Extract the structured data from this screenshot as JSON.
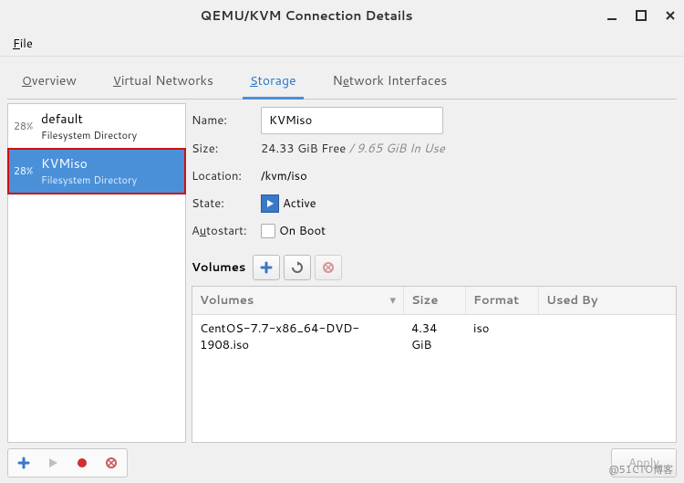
{
  "window": {
    "title": "QEMU/KVM Connection Details"
  },
  "menubar": {
    "file": "File"
  },
  "tabs": {
    "overview": "Overview",
    "virtual_networks": "Virtual Networks",
    "storage": "Storage",
    "network_interfaces": "Network Interfaces"
  },
  "pools": [
    {
      "percent": "28%",
      "name": "default",
      "type": "Filesystem Directory"
    },
    {
      "percent": "28%",
      "name": "KVMiso",
      "type": "Filesystem Directory"
    }
  ],
  "details": {
    "name_label": "Name:",
    "name_value": "KVMiso",
    "size_label": "Size:",
    "size_free": "24.33 GiB Free",
    "size_sep": " / ",
    "size_use": "9.65 GiB In Use",
    "location_label": "Location:",
    "location_value": "/kvm/iso",
    "state_label": "State:",
    "state_value": "Active",
    "autostart_label": "Autostart:",
    "autostart_value": "On Boot"
  },
  "volumes": {
    "header_label": "Volumes",
    "columns": {
      "volumes": "Volumes",
      "size": "Size",
      "format": "Format",
      "used_by": "Used By"
    },
    "rows": [
      {
        "name": "CentOS-7.7-x86_64-DVD-1908.iso",
        "size": "4.34 GiB",
        "format": "iso",
        "used_by": ""
      }
    ]
  },
  "bottom": {
    "apply": "Apply"
  },
  "watermark": "@51CTO博客"
}
